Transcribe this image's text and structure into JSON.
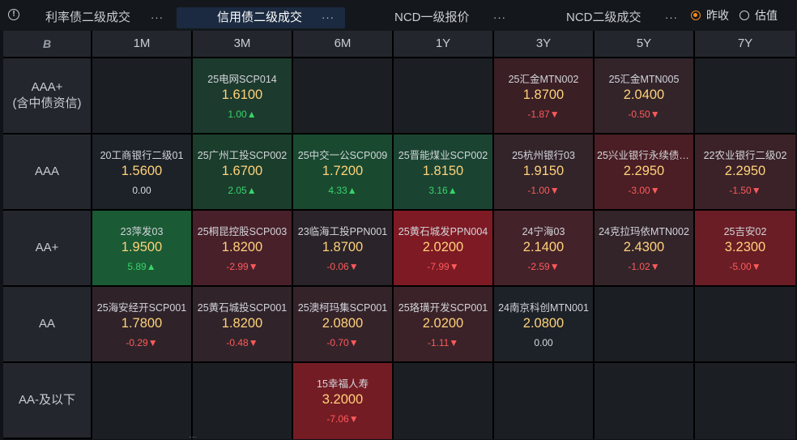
{
  "tabs": [
    {
      "label": "利率债二级成交",
      "more": "···",
      "active": false
    },
    {
      "label": "信用债二级成交",
      "more": "···",
      "active": true
    },
    {
      "label": "NCD一级报价",
      "more": "···",
      "active": false
    },
    {
      "label": "NCD二级成交",
      "more": "···",
      "active": false
    }
  ],
  "radios": [
    {
      "label": "昨收",
      "checked": true
    },
    {
      "label": "估值",
      "checked": false
    }
  ],
  "corner_icon": "B",
  "tenors": [
    "1M",
    "3M",
    "6M",
    "1Y",
    "3Y",
    "5Y",
    "7Y"
  ],
  "rows": [
    {
      "label": "AAA+\n(含中债资信)",
      "cells": [
        null,
        {
          "name": "25电网SCP014",
          "rate": "1.6100",
          "chg": "1.00▲",
          "dir": "up",
          "bg": "#1d3a2e"
        },
        null,
        null,
        {
          "name": "25汇金MTN002",
          "rate": "1.8700",
          "chg": "-1.87▼",
          "dir": "dn",
          "bg": "#3a1f25"
        },
        {
          "name": "25汇金MTN005",
          "rate": "2.0400",
          "chg": "-0.50▼",
          "dir": "dn",
          "bg": "#33242a"
        },
        null
      ]
    },
    {
      "label": "AAA",
      "cells": [
        {
          "name": "20工商银行二级01",
          "rate": "1.5600",
          "chg": "0.00",
          "dir": "fl",
          "bg": "#1d2228"
        },
        {
          "name": "25广州工投SCP002",
          "rate": "1.6700",
          "chg": "2.05▲",
          "dir": "up",
          "bg": "#1b3d2c"
        },
        {
          "name": "25中交一公SCP009",
          "rate": "1.7200",
          "chg": "4.33▲",
          "dir": "up",
          "bg": "#194a30"
        },
        {
          "name": "25晋能煤业SCP002",
          "rate": "1.8150",
          "chg": "3.16▲",
          "dir": "up",
          "bg": "#1a4431"
        },
        {
          "name": "25杭州银行03",
          "rate": "1.9150",
          "chg": "-1.00▼",
          "dir": "dn",
          "bg": "#33242a"
        },
        {
          "name": "25兴业银行永续债0...",
          "rate": "2.2950",
          "chg": "-3.00▼",
          "dir": "dn",
          "bg": "#4a1e24"
        },
        {
          "name": "22农业银行二级02",
          "rate": "2.2950",
          "chg": "-1.50▼",
          "dir": "dn",
          "bg": "#3b2228"
        }
      ]
    },
    {
      "label": "AA+",
      "cells": [
        {
          "name": "23萍发03",
          "rate": "1.9500",
          "chg": "5.89▲",
          "dir": "up",
          "bg": "#1a5a34"
        },
        {
          "name": "25桐昆控股SCP003",
          "rate": "1.8200",
          "chg": "-2.99▼",
          "dir": "dn",
          "bg": "#48202a"
        },
        {
          "name": "23临海工投PPN001",
          "rate": "1.8700",
          "chg": "-0.06▼",
          "dir": "dn",
          "bg": "#2a2329"
        },
        {
          "name": "25黄石城发PPN004",
          "rate": "2.0200",
          "chg": "-7.99▼",
          "dir": "dn",
          "bg": "#7e1a24"
        },
        {
          "name": "24宁海03",
          "rate": "2.1400",
          "chg": "-2.59▼",
          "dir": "dn",
          "bg": "#44222a"
        },
        {
          "name": "24克拉玛依MTN002",
          "rate": "2.4300",
          "chg": "-1.02▼",
          "dir": "dn",
          "bg": "#33242a"
        },
        {
          "name": "25吉安02",
          "rate": "3.2300",
          "chg": "-5.00▼",
          "dir": "dn",
          "bg": "#6a1d25"
        }
      ]
    },
    {
      "label": "AA",
      "cells": [
        {
          "name": "25海安经开SCP001",
          "rate": "1.7800",
          "chg": "-0.29▼",
          "dir": "dn",
          "bg": "#2f2329"
        },
        {
          "name": "25黄石城投SCP001",
          "rate": "1.8200",
          "chg": "-0.48▼",
          "dir": "dn",
          "bg": "#30242a"
        },
        {
          "name": "25澳柯玛集SCP001",
          "rate": "2.0800",
          "chg": "-0.70▼",
          "dir": "dn",
          "bg": "#35232a"
        },
        {
          "name": "25珞璜开发SCP001",
          "rate": "2.0200",
          "chg": "-1.11▼",
          "dir": "dn",
          "bg": "#3a2228"
        },
        {
          "name": "24南京科创MTN001",
          "rate": "2.0800",
          "chg": "0.00",
          "dir": "fl",
          "bg": "#1d2228"
        },
        null,
        null
      ]
    },
    {
      "label": "AA-及以下",
      "cells": [
        null,
        null,
        {
          "name": "15幸福人寿",
          "rate": "3.2000",
          "chg": "-7.06▼",
          "dir": "dn",
          "bg": "#741c24"
        },
        null,
        null,
        null,
        null
      ]
    }
  ]
}
